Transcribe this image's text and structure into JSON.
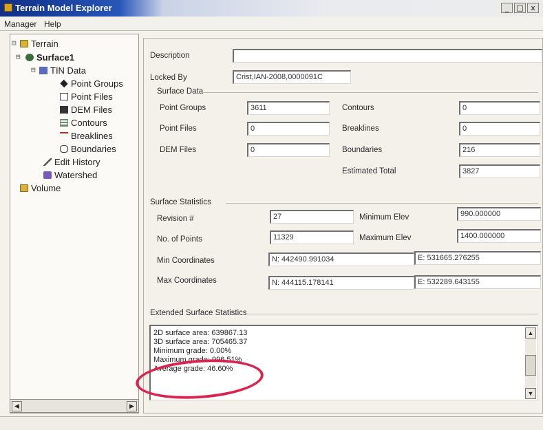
{
  "window": {
    "title": "Terrain Model Explorer",
    "minimize": "_",
    "maximize": "□",
    "close": "x"
  },
  "menu": [
    "Manager",
    "Help"
  ],
  "tree": {
    "root": "Terrain",
    "surface": "Surface1",
    "tin": "TIN Data",
    "children": [
      "Point Groups",
      "Point Files",
      "DEM Files",
      "Contours",
      "Breaklines",
      "Boundaries"
    ],
    "edit_history": "Edit History",
    "watershed": "Watershed",
    "volume": "Volume"
  },
  "details": {
    "description_label": "Description",
    "description_value": "",
    "locked_by_label": "Locked By",
    "locked_by_value": "Crist,IAN-2008,0000091C",
    "surface_data_title": "Surface Data",
    "point_groups_label": "Point Groups",
    "point_groups_value": "3611",
    "point_files_label": "Point Files",
    "point_files_value": "0",
    "dem_files_label": "DEM Files",
    "dem_files_value": "0",
    "contours_label": "Contours",
    "contours_value": "0",
    "breaklines_label": "Breaklines",
    "breaklines_value": "0",
    "boundaries_label": "Boundaries",
    "boundaries_value": "216",
    "estimated_total_label": "Estimated Total",
    "estimated_total_value": "3827",
    "surface_stats_title": "Surface Statistics",
    "revision_label": "Revision #",
    "revision_value": "27",
    "num_points_label": "No. of Points",
    "num_points_value": "11329",
    "min_coords_label": "Min Coordinates",
    "min_coords_n": "N: 442490.991034",
    "min_coords_e": "E: 531665.276255",
    "max_coords_label": "Max Coordinates",
    "max_coords_n": "N: 444115.178141",
    "max_coords_e": "E: 532289.643155",
    "min_elev_label": "Minimum Elev",
    "min_elev_value": "990.000000",
    "max_elev_label": "Maximum Elev",
    "max_elev_value": "1400.000000",
    "extended_title": "Extended Surface Statistics",
    "extended_lines": [
      "2D surface area: 639867.13",
      "3D surface area: 705465.37",
      "Minimum grade: 0.00%",
      "Maximum grade: 996.51%",
      "Average grade: 46.60%"
    ]
  },
  "colors": {
    "title_gradient_start": "#0f2f86",
    "highlight_ring": "#d8244f"
  },
  "icons": {
    "folder": "folder-icon",
    "surface": "surface-icon",
    "tin": "tin-data-icon",
    "point_groups": "point-groups-icon",
    "point_files": "point-file-icon",
    "dem_files": "dem-icon",
    "contours": "contours-icon",
    "breaklines": "breaklines-icon",
    "boundaries": "boundary-icon",
    "edit_history": "edit-icon",
    "watershed": "watershed-icon"
  }
}
